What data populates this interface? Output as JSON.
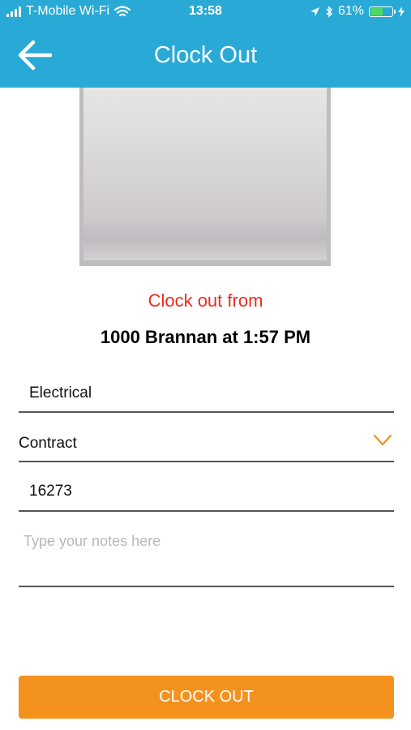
{
  "status_bar": {
    "carrier": "T-Mobile Wi-Fi",
    "time": "13:58",
    "battery": "61%",
    "battery_level": 0.61
  },
  "header": {
    "title": "Clock Out",
    "back_icon": "arrow-left-icon"
  },
  "clock_out": {
    "heading": "Clock out from",
    "location_time": "1000 Brannan at 1:57 PM"
  },
  "form": {
    "trade_value": "Electrical",
    "contract_value": "Contract",
    "code_value": "16273",
    "notes_placeholder": "Type your notes here"
  },
  "actions": {
    "clock_out_label": "CLOCK OUT"
  },
  "colors": {
    "header": "#29a9d5",
    "accent_red": "#ee2b1f",
    "button": "#f4921e"
  }
}
